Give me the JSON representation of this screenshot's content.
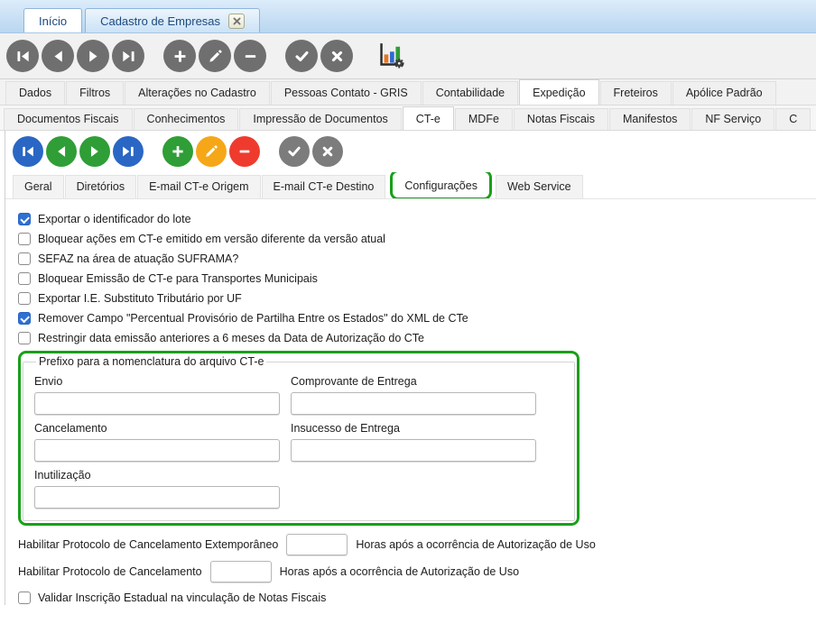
{
  "window_tabs": {
    "items": [
      {
        "label": "Início",
        "active": true,
        "closable": false
      },
      {
        "label": "Cadastro de Empresas",
        "active": false,
        "closable": true
      }
    ]
  },
  "main_toolbar": {
    "buttons": [
      {
        "icon": "first-record-icon",
        "glyph": "first",
        "color": "#6f6f6f"
      },
      {
        "icon": "previous-record-icon",
        "glyph": "prev",
        "color": "#6f6f6f"
      },
      {
        "icon": "next-record-icon",
        "glyph": "next",
        "color": "#6f6f6f"
      },
      {
        "icon": "last-record-icon",
        "glyph": "last",
        "color": "#6f6f6f"
      },
      {
        "icon": "add-record-icon",
        "glyph": "plus",
        "color": "#6f6f6f",
        "group_gap": true
      },
      {
        "icon": "edit-record-icon",
        "glyph": "pencil",
        "color": "#6f6f6f"
      },
      {
        "icon": "delete-record-icon",
        "glyph": "minus",
        "color": "#6f6f6f"
      },
      {
        "icon": "confirm-icon",
        "glyph": "check",
        "color": "#6f6f6f",
        "group_gap": true
      },
      {
        "icon": "cancel-icon",
        "glyph": "cross",
        "color": "#6f6f6f"
      }
    ],
    "chart_icon": "bar-chart-settings-icon"
  },
  "record_toolbar": {
    "buttons": [
      {
        "icon": "first-record-icon",
        "glyph": "first",
        "color": "#2a67c5"
      },
      {
        "icon": "previous-record-icon",
        "glyph": "prev",
        "color": "#2f9e37"
      },
      {
        "icon": "next-record-icon",
        "glyph": "next",
        "color": "#2f9e37"
      },
      {
        "icon": "last-record-icon",
        "glyph": "last",
        "color": "#2a67c5"
      },
      {
        "icon": "add-record-icon",
        "glyph": "plus",
        "color": "#2f9e37",
        "group_gap": true
      },
      {
        "icon": "edit-record-icon",
        "glyph": "pencil",
        "color": "#f6a718"
      },
      {
        "icon": "delete-record-icon",
        "glyph": "minus",
        "color": "#ef3b2d"
      },
      {
        "icon": "confirm-icon",
        "glyph": "check",
        "color": "#7c7c7c",
        "group_gap": true
      },
      {
        "icon": "cancel-icon",
        "glyph": "cross",
        "color": "#7c7c7c"
      }
    ]
  },
  "tab_rows": {
    "level1": [
      {
        "label": "Dados"
      },
      {
        "label": "Filtros"
      },
      {
        "label": "Alterações no Cadastro"
      },
      {
        "label": "Pessoas Contato - GRIS"
      },
      {
        "label": "Contabilidade"
      },
      {
        "label": "Expedição",
        "active": true
      },
      {
        "label": "Freteiros"
      },
      {
        "label": "Apólice Padrão"
      }
    ],
    "level2": [
      {
        "label": "Documentos Fiscais"
      },
      {
        "label": "Conhecimentos"
      },
      {
        "label": "Impressão de Documentos"
      },
      {
        "label": "CT-e",
        "active": true
      },
      {
        "label": "MDFe"
      },
      {
        "label": "Notas Fiscais"
      },
      {
        "label": "Manifestos"
      },
      {
        "label": "NF Serviço"
      },
      {
        "label": "C"
      }
    ],
    "level3": [
      {
        "label": "Geral"
      },
      {
        "label": "Diretórios"
      },
      {
        "label": "E-mail CT-e Origem"
      },
      {
        "label": "E-mail CT-e Destino"
      },
      {
        "label": "Configurações",
        "active": true,
        "highlighted": true
      },
      {
        "label": "Web Service"
      }
    ]
  },
  "options": [
    {
      "label": "Exportar o identificador do lote",
      "checked": true
    },
    {
      "label": "Bloquear ações em CT-e emitido em versão diferente da versão atual",
      "checked": false
    },
    {
      "label": "SEFAZ na área de atuação SUFRAMA?",
      "checked": false
    },
    {
      "label": "Bloquear Emissão de CT-e para Transportes Municipais",
      "checked": false
    },
    {
      "label": "Exportar I.E. Substituto Tributário por UF",
      "checked": false
    },
    {
      "label": "Remover Campo \"Percentual Provisório de Partilha Entre os Estados\" do XML de CTe",
      "checked": true
    },
    {
      "label": "Restringir data emissão anteriores a 6 meses da Data de Autorização do CTe",
      "checked": false
    }
  ],
  "prefix_group": {
    "title": "Prefixo para a nomenclatura do arquivo CT-e",
    "highlight_color": "#18a018",
    "fields": [
      {
        "label": "Envio",
        "value": ""
      },
      {
        "label": "Comprovante de Entrega",
        "value": ""
      },
      {
        "label": "Cancelamento",
        "value": ""
      },
      {
        "label": "Insucesso de Entrega",
        "value": ""
      },
      {
        "label": "Inutilização",
        "value": ""
      }
    ]
  },
  "protocol_rows": [
    {
      "label": "Habilitar Protocolo de Cancelamento Extemporâneo",
      "value": "",
      "suffix": "Horas após a ocorrência de Autorização de Uso"
    },
    {
      "label": "Habilitar Protocolo de Cancelamento",
      "value": "",
      "suffix": "Horas após a ocorrência de Autorização de Uso"
    }
  ],
  "bottom_option": {
    "label": "Validar Inscrição Estadual na vinculação de Notas Fiscais",
    "checked": false
  }
}
